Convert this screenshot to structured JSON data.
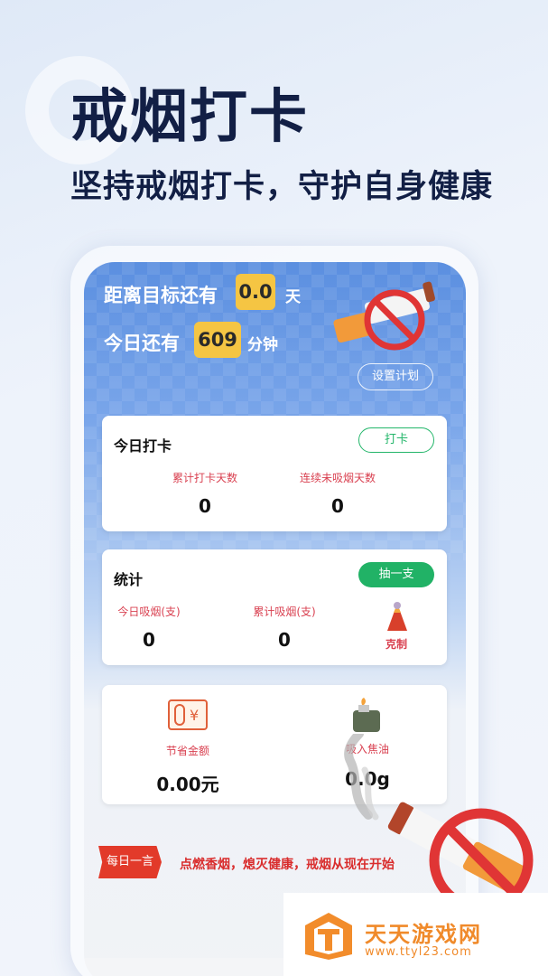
{
  "hero": {
    "title": "戒烟打卡",
    "subtitle": "坚持戒烟打卡，守护自身健康"
  },
  "header": {
    "target_label": "距离目标还有",
    "target_days": "0.0",
    "target_unit": "天",
    "today_label": "今日还有",
    "today_minutes": "609",
    "today_unit": "分钟",
    "plan_button": "设置计划"
  },
  "checkin_card": {
    "title": "今日打卡",
    "button": "打卡",
    "stats": [
      {
        "label": "累计打卡天数",
        "value": "0"
      },
      {
        "label": "连续未吸烟天数",
        "value": "0"
      }
    ]
  },
  "stats_card": {
    "title": "统计",
    "button": "抽一支",
    "stats": [
      {
        "label": "今日吸烟(支)",
        "value": "0"
      },
      {
        "label": "累计吸烟(支)",
        "value": "0"
      }
    ],
    "restrain_label": "克制"
  },
  "savings_card": {
    "money_label": "节省金额",
    "money_value": "0.00元",
    "tar_label": "吸入焦油",
    "tar_value": "0.0g"
  },
  "quote": {
    "tag": "每日一言",
    "text": "点燃香烟，熄灭健康，戒烟从现在开始"
  },
  "watermark": {
    "name": "天天游戏网",
    "url": "www.ttyl23.com"
  },
  "colors": {
    "accent_green": "#21b266",
    "badge_yellow": "#f5c543",
    "label_red": "#d94050",
    "title_navy": "#121f45"
  }
}
